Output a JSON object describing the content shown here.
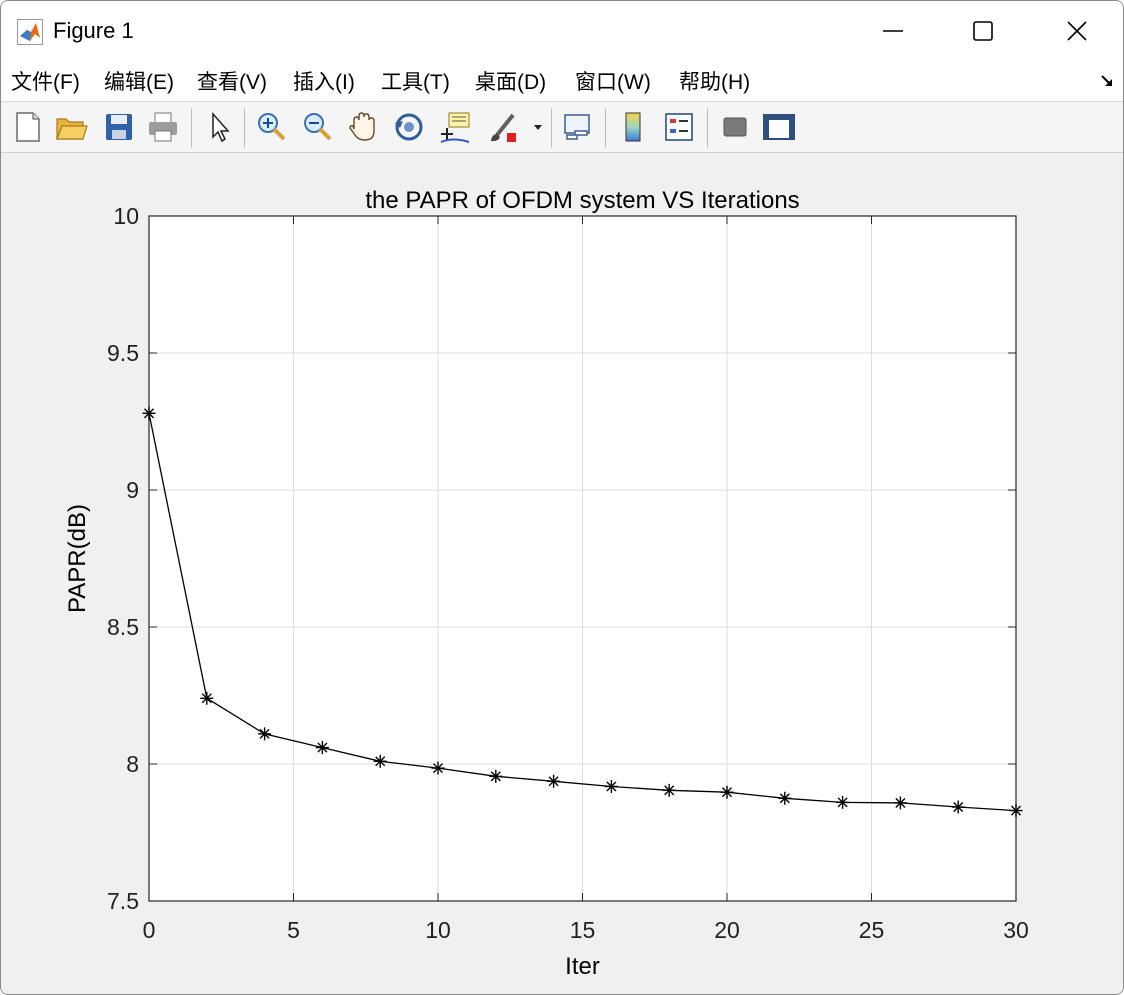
{
  "window": {
    "title": "Figure 1",
    "controls": {
      "minimize_icon": "minimize-icon",
      "maximize_icon": "maximize-icon",
      "close_icon": "close-icon"
    }
  },
  "menu": {
    "items": [
      "文件(F)",
      "编辑(E)",
      "查看(V)",
      "插入(I)",
      "工具(T)",
      "桌面(D)",
      "窗口(W)",
      "帮助(H)"
    ],
    "overflow_icon": "dock-arrow-icon"
  },
  "toolbar": {
    "buttons": [
      "new-figure-icon",
      "open-file-icon",
      "save-icon",
      "print-icon",
      "edit-plot-icon",
      "zoom-in-icon",
      "zoom-out-icon",
      "pan-icon",
      "rotate-3d-icon",
      "data-cursor-icon",
      "brush-icon",
      "link-plot-icon",
      "colorbar-icon",
      "legend-icon",
      "hide-plot-tools-icon",
      "show-plot-tools-icon"
    ]
  },
  "colors": {
    "line": "#000000",
    "grid": "#dedede",
    "axes_bg": "#ffffff",
    "figure_bg": "#f0f0f0"
  },
  "chart_data": {
    "type": "line",
    "title": "the PAPR of OFDM system VS Iterations",
    "xlabel": "Iter",
    "ylabel": "PAPR(dB)",
    "xlim": [
      0,
      30
    ],
    "ylim": [
      7.5,
      10
    ],
    "xticks": [
      "0",
      "5",
      "10",
      "15",
      "20",
      "25",
      "30"
    ],
    "yticks": [
      "7.5",
      "8",
      "8.5",
      "9",
      "9.5",
      "10"
    ],
    "grid": true,
    "marker": "asterisk",
    "series": [
      {
        "x": [
          0,
          2,
          4,
          6,
          8,
          10,
          12,
          14,
          16,
          18,
          20,
          22,
          24,
          26,
          28,
          30
        ],
        "values": [
          9.28,
          8.24,
          8.11,
          8.06,
          8.01,
          7.985,
          7.955,
          7.937,
          7.918,
          7.904,
          7.897,
          7.875,
          7.86,
          7.858,
          7.843,
          7.83
        ]
      }
    ]
  }
}
